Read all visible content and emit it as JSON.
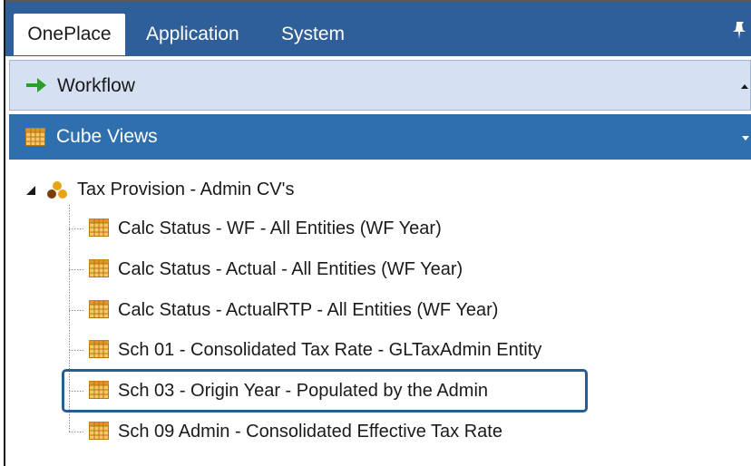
{
  "tabs": [
    {
      "label": "OnePlace",
      "active": true
    },
    {
      "label": "Application",
      "active": false
    },
    {
      "label": "System",
      "active": false
    }
  ],
  "panels": {
    "workflow": {
      "label": "Workflow",
      "icon": "green-arrow-right-icon"
    },
    "cube_views": {
      "label": "Cube Views",
      "icon": "cube-view-grid-icon"
    }
  },
  "tree": {
    "root": {
      "label": "Tax Provision - Admin CV's",
      "icon": "group-icon",
      "expanded": true
    },
    "items": [
      {
        "label": "Calc Status - WF - All Entities (WF Year)"
      },
      {
        "label": "Calc Status - Actual - All Entities (WF Year)"
      },
      {
        "label": "Calc Status - ActualRTP - All Entities (WF Year)"
      },
      {
        "label": "Sch 01 - Consolidated Tax Rate - GLTaxAdmin Entity"
      },
      {
        "label": "Sch 03 - Origin Year - Populated by the Admin",
        "selected": true
      },
      {
        "label": "Sch 09 Admin - Consolidated Effective Tax Rate"
      }
    ]
  },
  "colors": {
    "tab_bar": "#2f5f98",
    "cube_views_header": "#2f6fae",
    "workflow_header": "#d5e1f2",
    "selection_border": "#2a5d8f"
  }
}
